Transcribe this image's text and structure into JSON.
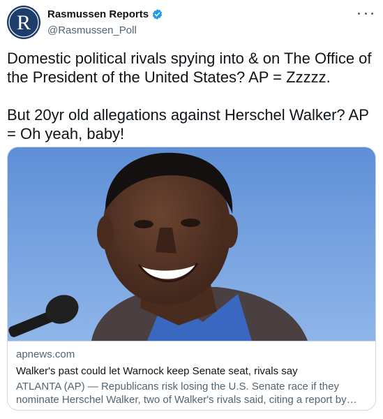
{
  "author": {
    "name": "Rasmussen Reports",
    "handle": "@Rasmussen_Poll",
    "verified": true,
    "avatar_icon": "rasmussen-logo-icon",
    "avatar_color": "#1d3d6b"
  },
  "tweet": {
    "paragraphs": [
      "Domestic political rivals spying into & on The Office of the President of the United States? AP = Zzzzz.",
      "But 20yr old allegations against Herschel Walker? AP = Oh yeah, baby!"
    ]
  },
  "card": {
    "image_icon": "herschel-walker-photo",
    "domain": "apnews.com",
    "title": "Walker's past could let Warnock keep Senate seat, rivals say",
    "description": "ATLANTA (AP) — Republicans risk losing the U.S. Senate race if they nominate Herschel Walker, two of Walker's rivals said, citing a report by The Associated Press"
  },
  "colors": {
    "text_primary": "#0f1419",
    "text_secondary": "#536471",
    "verified_blue": "#1d9bf0",
    "border": "#cfd9de"
  }
}
